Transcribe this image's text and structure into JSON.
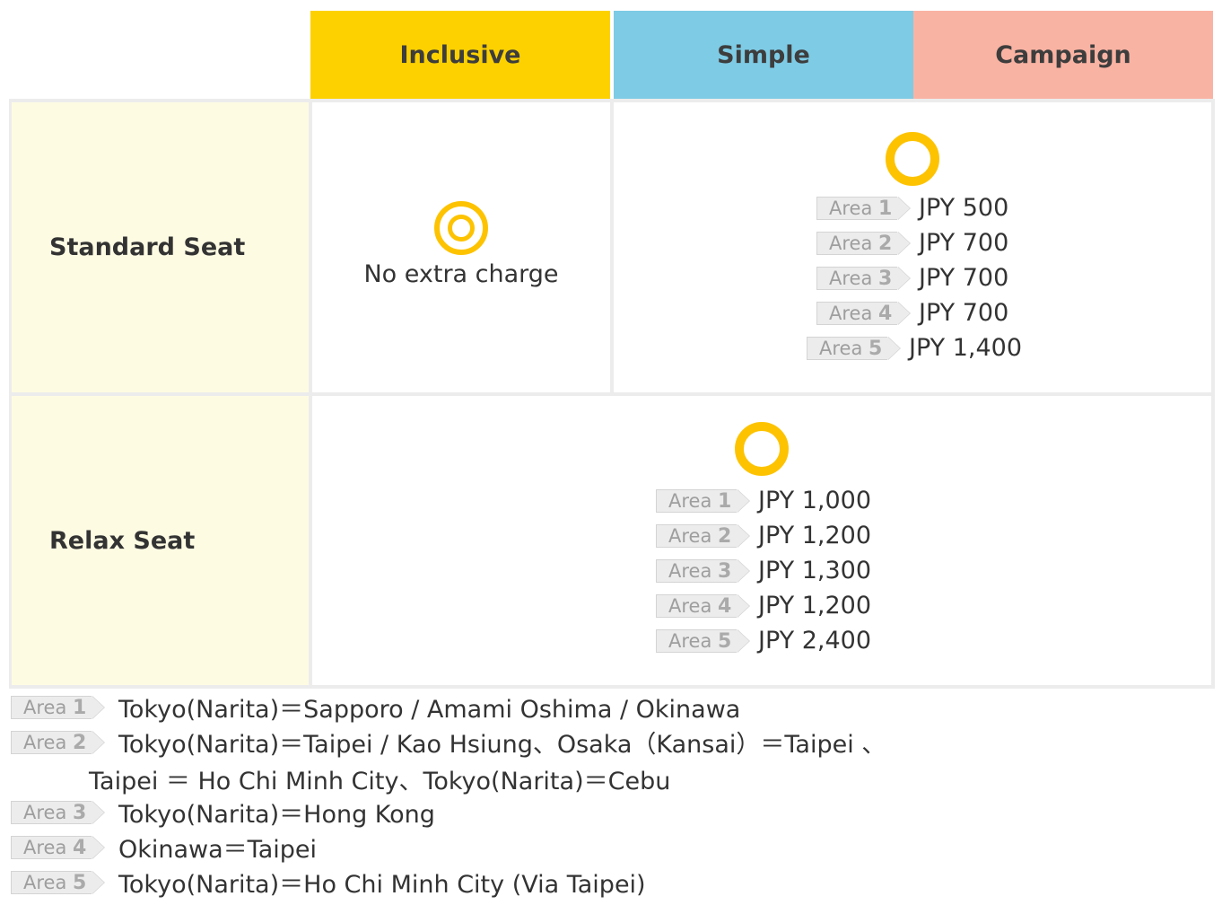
{
  "header": {
    "inclusive": "Inclusive",
    "simple": "Simple",
    "campaign": "Campaign"
  },
  "rows": {
    "standard": "Standard Seat",
    "relax": "Relax Seat"
  },
  "standard_inclusive": {
    "note": "No extra charge"
  },
  "area_tag": {
    "word": "Area",
    "n1": "1",
    "n2": "2",
    "n3": "3",
    "n4": "4",
    "n5": "5"
  },
  "standard_simple": {
    "prices": [
      "JPY 500",
      "JPY 700",
      "JPY 700",
      "JPY 700",
      "JPY 1,400"
    ]
  },
  "relax": {
    "prices": [
      "JPY 1,000",
      "JPY 1,200",
      "JPY 1,300",
      "JPY 1,200",
      "JPY 2,400"
    ]
  },
  "legend": {
    "area1": "Tokyo(Narita)＝Sapporo / Amami Oshima / Okinawa",
    "area2_line1": "Tokyo(Narita)＝Taipei / Kao Hsiung、Osaka（Kansai）＝Taipei 、",
    "area2_line2": "Taipei ＝ Ho Chi Minh City、Tokyo(Narita)＝Cebu",
    "area3": "Tokyo(Narita)＝Hong Kong",
    "area4": "Okinawa＝Taipei",
    "area5": "Tokyo(Narita)＝Ho Chi Minh City (Via Taipei)"
  },
  "colors": {
    "inclusive_header": "#fdd100",
    "simple_header": "#7ecbe5",
    "campaign_header": "#f9b3a3",
    "row_header_bg": "#fefbe3",
    "ring": "#fdc300"
  },
  "icons": {
    "double_circle": "double-circle-icon",
    "circle": "circle-icon"
  }
}
